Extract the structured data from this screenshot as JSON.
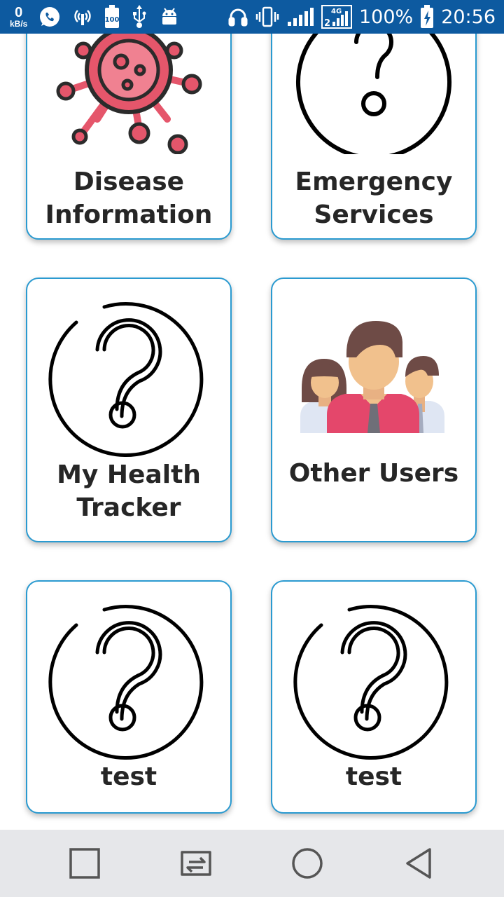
{
  "status_bar": {
    "net_speed_value": "0",
    "net_speed_unit": "kB/s",
    "left_icons": [
      "whatsapp-icon",
      "hotspot-icon",
      "battery-100-icon",
      "usb-icon",
      "android-debug-icon"
    ],
    "right_icons": [
      "headset-icon",
      "vibrate-icon",
      "signal-icon",
      "lte-signal-icon",
      "battery-charging-icon"
    ],
    "network_type": "4G",
    "battery": "100%",
    "time": "20:56"
  },
  "cards": [
    {
      "label": "Disease Information",
      "icon": "virus-icon"
    },
    {
      "label": "Emergency Services",
      "icon": "question-mark-icon"
    },
    {
      "label": "My Health Tracker",
      "icon": "question-mark-icon"
    },
    {
      "label": "Other Users",
      "icon": "users-group-icon"
    },
    {
      "label": "test",
      "icon": "question-mark-icon"
    },
    {
      "label": "test",
      "icon": "question-mark-icon"
    }
  ],
  "nav_bar": {
    "buttons": [
      "recent-apps-icon",
      "switch-app-icon",
      "home-icon",
      "back-icon"
    ]
  },
  "colors": {
    "status_bar": "#0d5aa0",
    "card_border": "#2a9ad0",
    "virus": "#e5566b",
    "nav_bar": "#e6e7ea"
  }
}
